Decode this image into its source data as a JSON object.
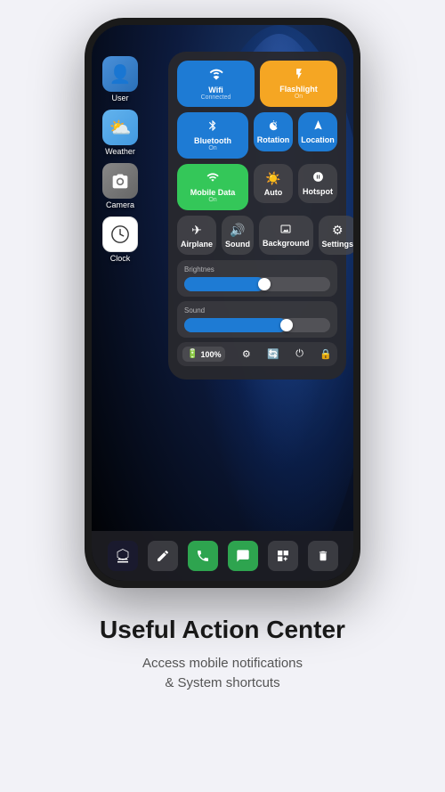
{
  "phone": {
    "homeIcons": [
      {
        "id": "user",
        "label": "User",
        "emoji": "👤",
        "colorClass": "icon-user"
      },
      {
        "id": "weather",
        "label": "Weather",
        "emoji": "⛅",
        "colorClass": "icon-weather"
      },
      {
        "id": "camera",
        "label": "Camera",
        "emoji": "📷",
        "colorClass": "icon-camera"
      },
      {
        "id": "clock",
        "label": "Clock",
        "emoji": "🕐",
        "colorClass": "icon-clock"
      }
    ],
    "controlCenter": {
      "tiles": {
        "wifi": {
          "label": "Wifi",
          "sublabel": "Connected",
          "icon": "📶"
        },
        "flashlight": {
          "label": "Flashlight",
          "sublabel": "On",
          "icon": "🔦"
        },
        "bluetooth": {
          "label": "Bluetooth",
          "sublabel": "On",
          "icon": "🔵"
        },
        "rotation": {
          "label": "Rotation",
          "sublabel": "",
          "icon": "🔒"
        },
        "location": {
          "label": "Location",
          "sublabel": "",
          "icon": "➤"
        },
        "mobileData": {
          "label": "Mobile Data",
          "sublabel": "On",
          "icon": "📡"
        },
        "auto": {
          "label": "Auto",
          "sublabel": "",
          "icon": "☀"
        },
        "hotspot": {
          "label": "Hotspot",
          "sublabel": "",
          "icon": "🔗"
        },
        "airplane": {
          "label": "Airplane",
          "sublabel": "",
          "icon": "✈"
        },
        "sound": {
          "label": "Sound",
          "sublabel": "",
          "icon": "🔊"
        },
        "background": {
          "label": "Background",
          "sublabel": "",
          "icon": "🖼"
        },
        "settings": {
          "label": "Settings",
          "sublabel": "",
          "icon": "⚙"
        }
      },
      "brightness": {
        "label": "Brightnes",
        "percent": 55
      },
      "sound": {
        "label": "Sound",
        "percent": 70
      },
      "battery": {
        "percent": "100%"
      }
    }
  },
  "footer": {
    "title": "Useful Action Center",
    "subtitle": "Access mobile notifications\n& System shortcuts"
  },
  "dock": {
    "icons": [
      "🍎",
      "📝",
      "📞",
      "💬",
      "📋",
      "🗑"
    ]
  }
}
